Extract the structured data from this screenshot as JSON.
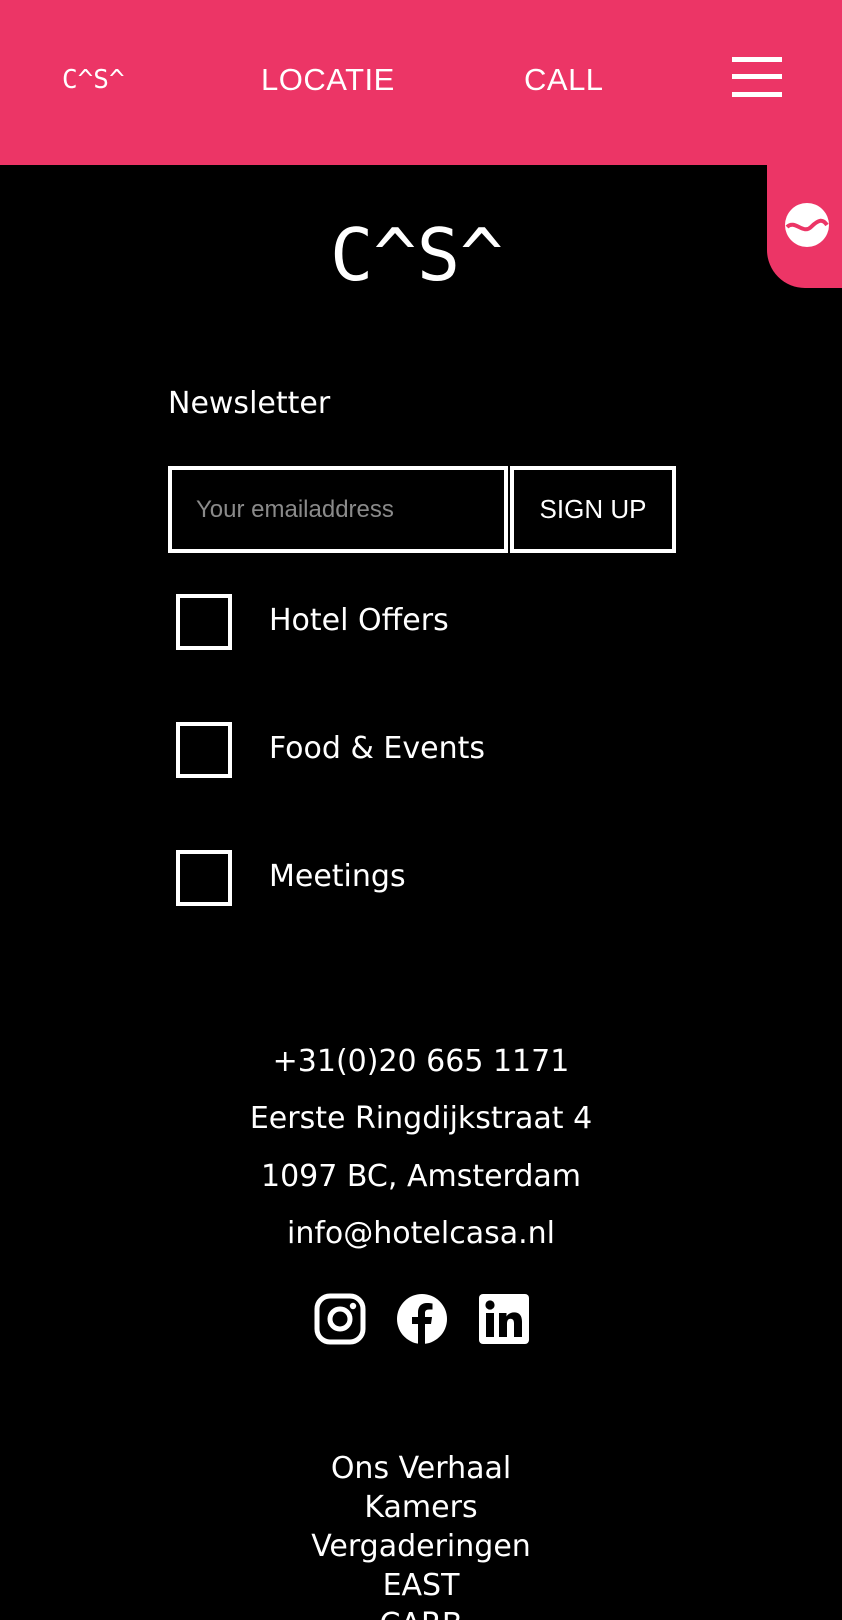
{
  "header": {
    "logo_text": "C^S^",
    "nav": {
      "locatie": "LOCATIE",
      "call": "CALL"
    },
    "menu_icon": "hamburger-icon",
    "background_color": "#ec3566"
  },
  "language_toggle": {
    "icon": "language-toggle-icon"
  },
  "footer_logo_text": "C^S^",
  "newsletter": {
    "title": "Newsletter",
    "email_placeholder": "Your emailaddress",
    "email_value": "",
    "signup_label": "SIGN UP",
    "options": [
      {
        "label": "Hotel Offers",
        "checked": false
      },
      {
        "label": "Food & Events",
        "checked": false
      },
      {
        "label": "Meetings",
        "checked": false
      }
    ]
  },
  "contact": {
    "phone": "+31(0)20 665 1171",
    "street": "Eerste Ringdijkstraat 4",
    "city": "1097 BC, Amsterdam",
    "email": "info@hotelcasa.nl"
  },
  "social": [
    "instagram-icon",
    "facebook-icon",
    "linkedin-icon"
  ],
  "footer_links": [
    "Ons Verhaal",
    "Kamers",
    "Vergaderingen",
    "EAST",
    "CARB"
  ]
}
